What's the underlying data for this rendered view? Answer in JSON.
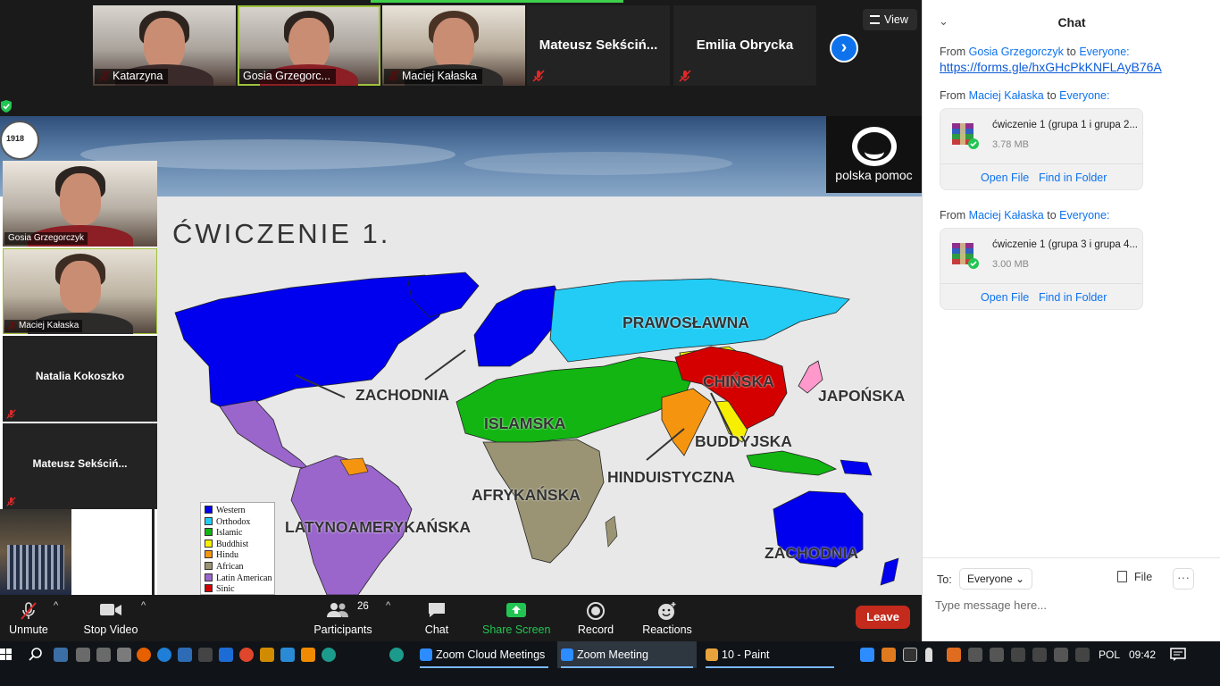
{
  "participants_strip": {
    "tiles": [
      {
        "name": "Katarzyna",
        "type": "video"
      },
      {
        "name": "Gosia Grzegorc...",
        "type": "video",
        "active": true
      },
      {
        "name": "Maciej Kałaska",
        "type": "video"
      },
      {
        "name": "Mateusz  Sekściń...",
        "type": "name"
      },
      {
        "name": "Emilia Obrycka",
        "type": "name"
      }
    ],
    "view_label": "View"
  },
  "slide": {
    "title": "ĆWICZENIE 1.",
    "logo_text": "polska pomoc",
    "seal_text": "1918",
    "regions": {
      "western_na": "ZACHODNIA",
      "orthodox": "PRAWOSŁAWNA",
      "islamic": "ISLAMSKA",
      "chinese": "CHIŃSKA",
      "japanese": "JAPOŃSKA",
      "buddhist": "BUDDYJSKA",
      "hindu": "HINDUISTYCZNA",
      "african": "AFRYKAŃSKA",
      "latin": "LATYNOAMERYKAŃSKA",
      "western_au": "ZACHODNIA"
    },
    "legend": [
      {
        "label": "Western",
        "color": "#0000ee"
      },
      {
        "label": "Orthodox",
        "color": "#22ccf5"
      },
      {
        "label": "Islamic",
        "color": "#12b512"
      },
      {
        "label": "Buddhist",
        "color": "#f6f000"
      },
      {
        "label": "Hindu",
        "color": "#f5950f"
      },
      {
        "label": "African",
        "color": "#9a9474"
      },
      {
        "label": "Latin American",
        "color": "#9a66cc"
      },
      {
        "label": "Sinic",
        "color": "#d40000"
      }
    ]
  },
  "gallery": [
    {
      "name": "Gosia Grzegorczyk",
      "type": "video",
      "muted": false
    },
    {
      "name": "Maciej Kałaska",
      "type": "video",
      "muted": true,
      "active": true
    },
    {
      "name": "Natalia Kokoszko",
      "type": "name",
      "muted": true
    },
    {
      "name": "Mateusz  Sekściń...",
      "type": "name",
      "muted": true
    }
  ],
  "toolbar": {
    "unmute": "Unmute",
    "stop_video": "Stop Video",
    "participants": "Participants",
    "participants_count": "26",
    "chat": "Chat",
    "share_screen": "Share Screen",
    "record": "Record",
    "reactions": "Reactions",
    "leave": "Leave"
  },
  "chat": {
    "title": "Chat",
    "messages": [
      {
        "from_label": "From",
        "sender": "Gosia Grzegorczyk",
        "to_label": "to",
        "recipient": "Everyone:",
        "link": "https://forms.gle/hxGHcPkKNFLAyB76A"
      },
      {
        "from_label": "From",
        "sender": "Maciej Kałaska",
        "to_label": "to",
        "recipient": "Everyone:",
        "file_name": "ćwiczenie 1 (grupa 1 i grupa 2...",
        "file_size": "3.78 MB"
      },
      {
        "from_label": "From",
        "sender": "Maciej Kałaska",
        "to_label": "to",
        "recipient": "Everyone:",
        "file_name": "ćwiczenie 1 (grupa 3 i grupa 4...",
        "file_size": "3.00 MB"
      }
    ],
    "open_file": "Open File",
    "find_in_folder": "Find in Folder",
    "to_label": "To:",
    "to_value": "Everyone",
    "file_button": "File",
    "more_button": "···",
    "input_placeholder": "Type message here..."
  },
  "taskbar": {
    "items": [
      {
        "label": "Zoom Cloud Meetings"
      },
      {
        "label": "Zoom Meeting",
        "active": true
      },
      {
        "label": "10 - Paint"
      }
    ],
    "language": "POL",
    "clock": "09:42"
  },
  "colors": {
    "zoom_blue": "#0e72ed",
    "leave_red": "#c42b1c",
    "share_green": "#23c552",
    "active_border": "#9ec23b"
  }
}
